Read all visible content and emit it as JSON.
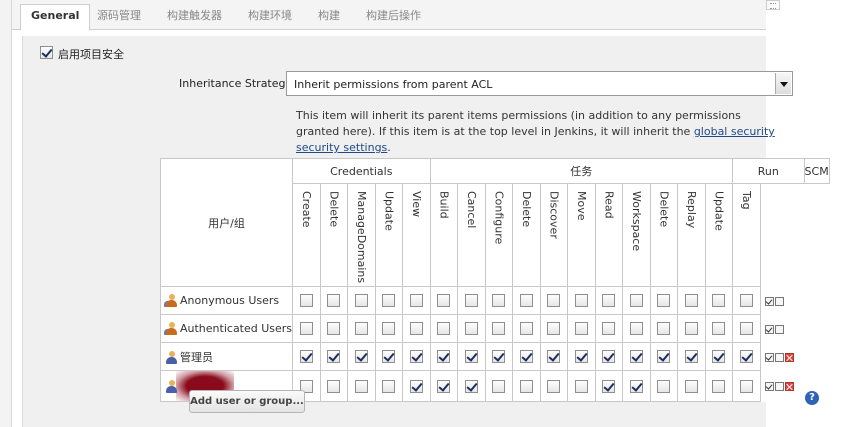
{
  "tabs": [
    {
      "label": "General",
      "active": true
    },
    {
      "label": "源码管理",
      "active": false
    },
    {
      "label": "构建触发器",
      "active": false
    },
    {
      "label": "构建环境",
      "active": false
    },
    {
      "label": "构建",
      "active": false
    },
    {
      "label": "构建后操作",
      "active": false
    }
  ],
  "security": {
    "enable_label": "启用项目安全",
    "enabled": true,
    "strategy_label": "Inheritance Strategy",
    "strategy_value": "Inherit permissions from parent ACL",
    "help_text_1": "This item will inherit its parent items permissions (in addition to any permissions granted here). If this item is at the top level in Jenkins, it will inherit the ",
    "help_link": "global security security settings",
    "help_text_2": "."
  },
  "matrix": {
    "user_header": "用户/组",
    "groups": [
      {
        "label": "Credentials",
        "span": 5
      },
      {
        "label": "任务",
        "span": 11
      },
      {
        "label": "Run",
        "span": 3
      },
      {
        "label": "SCM",
        "span": 1
      }
    ],
    "permissions": [
      "Create",
      "Delete",
      "ManageDomains",
      "Update",
      "View",
      "Build",
      "Cancel",
      "Configure",
      "Delete",
      "Discover",
      "Move",
      "Read",
      "Workspace",
      "Delete",
      "Replay",
      "Update",
      "Tag"
    ],
    "rows": [
      {
        "name": "Anonymous Users",
        "icon": "group-user-icon",
        "checks": [
          false,
          false,
          false,
          false,
          false,
          false,
          false,
          false,
          false,
          false,
          false,
          false,
          false,
          false,
          false,
          false,
          false
        ],
        "deletable": false,
        "redacted": false
      },
      {
        "name": "Authenticated Users",
        "icon": "group-user-icon",
        "checks": [
          false,
          false,
          false,
          false,
          false,
          false,
          false,
          false,
          false,
          false,
          false,
          false,
          false,
          false,
          false,
          false,
          false
        ],
        "deletable": false,
        "redacted": false
      },
      {
        "name": "管理员",
        "icon": "user-icon",
        "checks": [
          true,
          true,
          true,
          true,
          true,
          true,
          true,
          true,
          true,
          true,
          true,
          true,
          true,
          true,
          true,
          true,
          true
        ],
        "deletable": true,
        "redacted": false
      },
      {
        "name": "",
        "icon": "user-icon",
        "checks": [
          false,
          false,
          false,
          false,
          true,
          true,
          true,
          false,
          false,
          false,
          false,
          true,
          true,
          false,
          false,
          false,
          false
        ],
        "deletable": true,
        "redacted": true
      }
    ],
    "add_button": "Add user or group..."
  },
  "help_icon": "?"
}
